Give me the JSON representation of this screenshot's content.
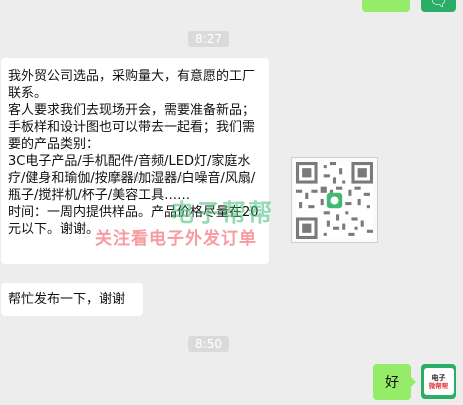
{
  "timestamps": [
    "8:27",
    "8:50"
  ],
  "messages": {
    "incoming_1": "我外贸公司选品，采购量大，有意愿的工厂联系。\n客人要求我们去现场开会，需要准备新品；手板样和设计图也可以带去一起看；我们需要的产品类别：\n3C电子产品/手机配件/音频/LED灯/家庭水疗/健身和瑜伽/按摩器/加湿器/白噪音/风扇/瓶子/搅拌机/杯子/美容工具……\n时间：一周内提供样品。产品价格尽量在20元以下。谢谢。",
    "incoming_2": "帮忙发布一下，谢谢",
    "outgoing_reply": "好"
  },
  "watermark": {
    "url": "dzwbbb.com",
    "brand": "电子帮帮",
    "slogan": "关注看电子外发订单"
  },
  "avatar": {
    "line1": "电子",
    "line2": "微帮帮"
  },
  "colors": {
    "background": "#ededed",
    "outgoing_bubble": "#95ec69",
    "incoming_bubble": "#ffffff",
    "avatar_green": "#2aae67",
    "watermark_green": "#40b972",
    "watermark_red": "#f25860"
  },
  "icons": {
    "top_avatar": "chat-bubble-icon",
    "qr": "qr-code-icon"
  }
}
